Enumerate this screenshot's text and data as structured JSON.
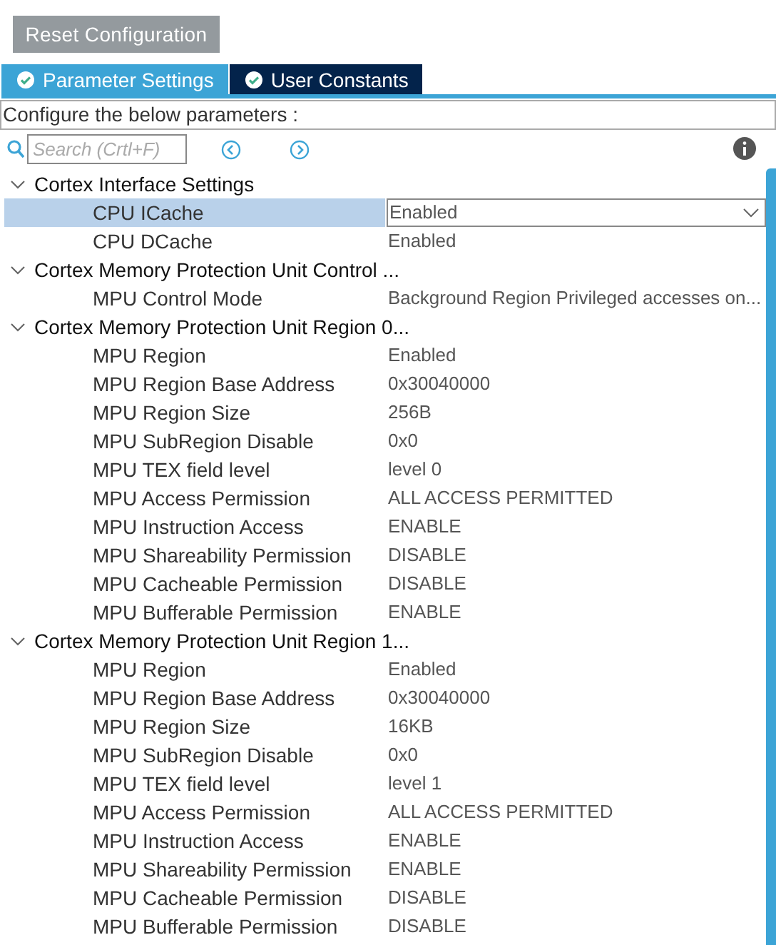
{
  "reset_button": "Reset Configuration",
  "tabs": [
    {
      "label": "Parameter Settings",
      "selected": true
    },
    {
      "label": "User Constants",
      "selected": false
    }
  ],
  "description": "Configure the below parameters :",
  "search": {
    "placeholder": "Search (Crtl+F)"
  },
  "groups": [
    {
      "label": "Cortex Interface Settings",
      "expanded": true,
      "children": [
        {
          "name": "CPU ICache",
          "value": "Enabled",
          "selected": true
        },
        {
          "name": "CPU DCache",
          "value": "Enabled",
          "selected": false
        }
      ]
    },
    {
      "label": "Cortex Memory Protection Unit Control ...",
      "expanded": true,
      "children": [
        {
          "name": "MPU Control Mode",
          "value": "Background Region Privileged accesses on...",
          "selected": false
        }
      ]
    },
    {
      "label": "Cortex Memory Protection Unit Region 0...",
      "expanded": true,
      "children": [
        {
          "name": "MPU Region",
          "value": "Enabled",
          "selected": false
        },
        {
          "name": "MPU Region Base Address",
          "value": "0x30040000",
          "selected": false
        },
        {
          "name": "MPU Region Size",
          "value": "256B",
          "selected": false
        },
        {
          "name": "MPU SubRegion Disable",
          "value": "0x0",
          "selected": false
        },
        {
          "name": "MPU TEX field level",
          "value": "level 0",
          "selected": false
        },
        {
          "name": "MPU Access Permission",
          "value": "ALL ACCESS PERMITTED",
          "selected": false
        },
        {
          "name": "MPU Instruction Access",
          "value": "ENABLE",
          "selected": false
        },
        {
          "name": "MPU Shareability Permission",
          "value": "DISABLE",
          "selected": false
        },
        {
          "name": "MPU Cacheable Permission",
          "value": "DISABLE",
          "selected": false
        },
        {
          "name": "MPU Bufferable  Permission",
          "value": "ENABLE",
          "selected": false
        }
      ]
    },
    {
      "label": "Cortex Memory Protection Unit Region 1...",
      "expanded": true,
      "children": [
        {
          "name": "MPU Region",
          "value": "Enabled",
          "selected": false
        },
        {
          "name": "MPU Region Base Address",
          "value": "0x30040000",
          "selected": false
        },
        {
          "name": "MPU Region Size",
          "value": "16KB",
          "selected": false
        },
        {
          "name": "MPU SubRegion Disable",
          "value": "0x0",
          "selected": false
        },
        {
          "name": "MPU TEX field level",
          "value": "level 1",
          "selected": false
        },
        {
          "name": "MPU Access Permission",
          "value": "ALL ACCESS PERMITTED",
          "selected": false
        },
        {
          "name": "MPU Instruction Access",
          "value": "ENABLE",
          "selected": false
        },
        {
          "name": "MPU Shareability Permission",
          "value": "ENABLE",
          "selected": false
        },
        {
          "name": "MPU Cacheable Permission",
          "value": "DISABLE",
          "selected": false
        },
        {
          "name": "MPU Bufferable  Permission",
          "value": "DISABLE",
          "selected": false
        }
      ]
    }
  ]
}
